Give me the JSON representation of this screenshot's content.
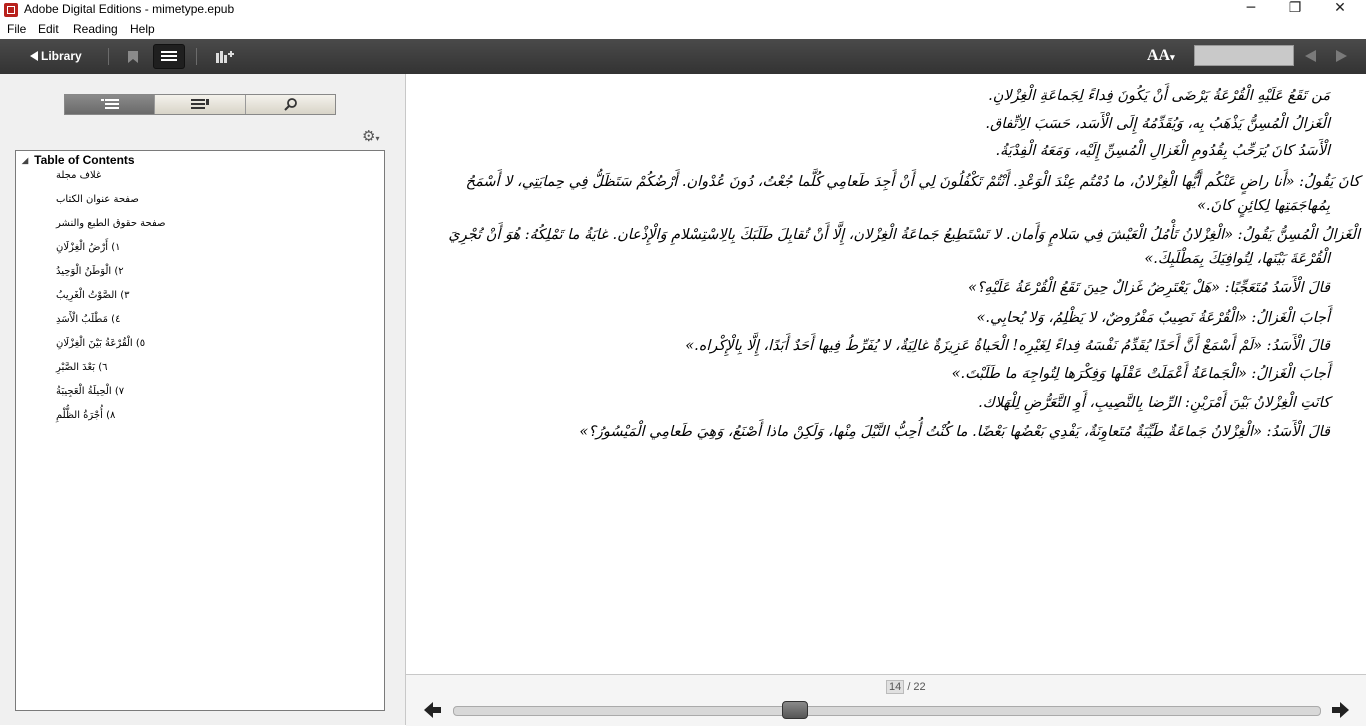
{
  "window": {
    "title": "Adobe Digital Editions - mimetype.epub",
    "controls": [
      "─",
      "❐",
      "✕"
    ]
  },
  "menu": [
    "File",
    "Edit",
    "Reading",
    "Help"
  ],
  "toolbar": {
    "library_label": "Library",
    "font_size_glyph": "AA",
    "search_value": ""
  },
  "sidebar": {
    "toc_title": "Table of Contents",
    "toc_items": [
      "غلاف مجلة",
      "صفحة عنوان الكتاب",
      "صفحة حقوق الطبع والنشر",
      "١) أَرْضُ الْغِزْلَانِ",
      "٢) الْوَطَنُ الْوَحِيدُ",
      "٣) الصَّوْتُ الْغَرِيبُ",
      "٤) مَطْلَبُ الْأَسَدِ",
      "٥) الْقُرْعَةُ بَيْنَ الْغِزْلَانِ",
      "٦) بَعْدَ الصَّبْرِ",
      "٧) الْحِيلَةُ الْعَجِيبَةُ",
      "٨) أُجْرَةُ الظُّلْمِ"
    ]
  },
  "content": {
    "lines": [
      "مَن تَقَعُ عَلَيْهِ الْقُرْعَةُ يَرْضَى أَنْ يَكُونَ فِداءً لِجَماعَةِ الْغِزْلانِ.",
      "الْغَزالُ الْمُسِنُّ يَذْهَبُ بِه، وَيُقَدِّمُهُ إِلَى الْأَسَد، حَسَبَ الِاتِّفاق.",
      "الْأَسَدُ كانَ يُرَحِّبُ بِقُدُومِ الْغَزالِ الْمُسِنِّ إِلَيْه، وَمَعَهُ الْفِدْيَةُ.",
      "كانَ يَقُولُ: «أَنا راضٍ عَنْكُم أَيُّها الْغِزْلانُ، ما دُمْتُم عِنْدَ الْوَعْدِ. أَنْتُمْ تَكْفُلُونَ لِي أَنْ أَجِدَ طَعامِي كُلَّما جُعْتُ، دُونَ عُدْوان. أَرْضُكُمْ سَتَظَلُّ فِي حِمايَتِي، لا أَسْمَحُ",
      "بِمُهاجَمَتِها لِكائِنٍ كانَ.»",
      "الْغَزالُ الْمُسِنُّ يَقُولُ: «الْغِزْلانُ تَأْمُلُ الْعَيْشَ فِي سَلامٍ وَأَمان. لا تَسْتَطِيعُ جَماعَةُ الْغِزْلان، إِلَّا أَنْ تُقابِلَ طَلَبَكَ بِالِاسْتِسْلامِ وَالْإِذْعان. غايَةُ ما تَمْلِكُهُ: هُوَ أَنْ تُجْرِيَ",
      "الْقُرْعَةَ بَيْنَها، لِتُوافِيَكَ بِمَطْلَبِكَ.»",
      "قالَ الْأَسَدُ مُتَعَجِّبًا: «هَلْ يَعْتَرِضُ غَزالٌ حِينَ تَقَعُ الْقُرْعَةُ عَلَيْهِ؟»",
      "أَجابَ الْغَزالُ: «الْقُرْعَةُ نَصِيبٌ مَفْرُوضٌ، لا يَظْلِمُ، وَلا يُحابِي.»",
      "قالَ الْأَسَدُ: «لَمْ أَسْمَعْ أَنَّ أَحَدًا يُقَدِّمُ نَفْسَهُ فِداءً لِغَيْرِه! الْحَياةُ عَزِيزَةٌ غالِيَةٌ، لا يُفَرِّطُ فِيها أَحَدٌ أَبَدًا، إِلَّا بِالْإِكْراه.»",
      "أَجابَ الْغَزالُ: «الْجَماعَةُ أَعْمَلَتْ عَقْلَها وَفِكْرَها لِتُواجِهَ ما طَلَبْتَ.»",
      "كانَتِ الْغِزْلانُ بَيْنَ أَمْرَيْنِ: الرِّضا بِالنَّصِيبِ، أَوِ التَّعَرُّضِ لِلْهَلاك.",
      "قالَ الْأَسَدُ: «الْغِزْلانُ جَماعَةٌ طَيِّبَةٌ مُتَعاوِنَةٌ، يَفْدِي بَعْضُها بَعْضًا. ما كُنْتُ أُحِبُّ النَّيْلَ مِنْها، وَلَكِنْ ماذا أَصْنَعُ، وَهِيَ طَعامِي الْمَيْسُورُ؟»"
    ]
  },
  "footer": {
    "current_page": "14",
    "total_pages": "/ 22",
    "progress_fraction": 0.39
  }
}
